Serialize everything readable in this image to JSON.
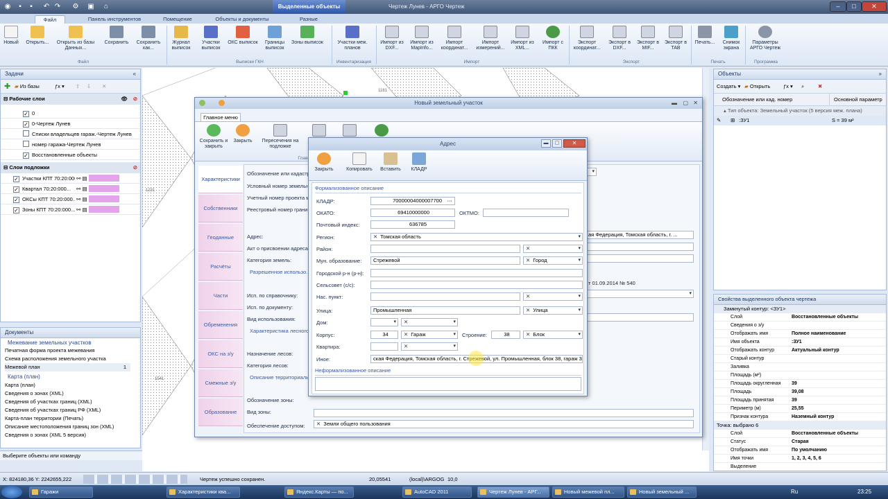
{
  "titlebar": {
    "context_tab": "Выделенные объекты",
    "app_title": "Чертеж Лунев - АРГО Чертеж"
  },
  "ribbon_tabs": [
    "Файл",
    "Панель инструментов",
    "Помещение",
    "Объекты и документы",
    "Разные"
  ],
  "ribbon": {
    "buttons": [
      "Новый",
      "Открыть...",
      "Открыть из базы Данных...",
      "Сохранить",
      "Сохранить как...",
      "Журнал выписок",
      "Участки выписок",
      "ОКС выписок",
      "Границы выписок",
      "Зоны выписок",
      "Участки меж. планов",
      "Импорт из DXF...",
      "Импорт из MapInfo...",
      "Импорт координат...",
      "Импорт измерений...",
      "Импорт из XML...",
      "Импорт с ПКК",
      "Экспорт координат...",
      "Экспорт в DXF...",
      "Экспорт в MIF...",
      "Экспорт в TAB",
      "Печать...",
      "Снимок экрана",
      "Параметры АРГО Чертеж"
    ],
    "groups": [
      "Файл",
      "Выписки ГКН",
      "Инвентаризация",
      "Импорт",
      "Экспорт",
      "Печать",
      "Программа"
    ]
  },
  "tasks": {
    "title": "Задачи",
    "from_db": "Из базы",
    "work_layers": {
      "title": "Рабочие слои",
      "items": [
        "0",
        "0-Чертеж Лунев",
        "Списки владельцев гараж.-Чертеж Лунев",
        "номер гаража-Чертеж Лунев",
        "Восстановленные объекты"
      ]
    },
    "base_layers": {
      "title": "Слои подложки",
      "items": [
        "Участки КПТ 70:20:000...",
        "Квартал 70:20:000...",
        "ОКСы КПТ 70:20:000...",
        "Зоны КПТ 70:20:000..."
      ]
    }
  },
  "documents": {
    "title": "Документы",
    "group1": "Межевание земельных участков",
    "items1": [
      "Печатная форма проекта межевания",
      "Схема расположения земельного участка",
      "Межевой план"
    ],
    "count": "1",
    "group2": "Карта (план)",
    "items2": [
      "Карта (план)",
      "Сведения о зонах (XML)",
      "Сведения об участках границ (XML)",
      "Сведения об участках границ РФ (XML)",
      "Карта-план территории (Печать)",
      "Описание местоположения границ зон (XML)",
      "Сведения о зонах (XML 5 версия)"
    ]
  },
  "command_hint": "Выберите объекты или команду",
  "map_labels": [
    "1181",
    "1231",
    "1541"
  ],
  "land_window": {
    "title": "Новый земельный участок",
    "menu_tab": "Главное меню",
    "buttons": [
      "Сохранить и закрыть",
      "Закрыть",
      "Пересечения на подложке"
    ],
    "menu_group": "Главное меню",
    "tabs": [
      "Характеристики",
      "Собственники",
      "Геоданные",
      "Расчёты",
      "Части",
      "Обременения",
      "ОКС на з/у",
      "Смежные з/у",
      "Образование"
    ],
    "labels": [
      "Обозначение или кадастр...",
      "Условный номер земельно...",
      "Учетный номер проекта м...",
      "Реестровый номер границ...",
      "Адрес:",
      "Акт о присвоении адреса:",
      "Категория земель:",
      "Исп. по справочнику:",
      "Исп. по документу:",
      "Вид использования:",
      "Назначение лесов:",
      "Категория лесов:",
      "Обозначение зоны:",
      "Вид зоны:",
      "Обеспечение доступом:"
    ],
    "sections": [
      "Разрешенное использо...",
      "Характеристика лесного ...",
      "Описание территориальн..."
    ],
    "address_value": "ая Федерация, Томская область, г. ...",
    "decree": "т 01.09.2014 № 540",
    "access_value": "Земли общего пользования"
  },
  "address_window": {
    "title": "Адрес",
    "buttons": [
      "Закрыть",
      "Копировать",
      "Вставить",
      "КЛАДР"
    ],
    "formal": "Формализованное описание",
    "informal": "Неформализованное описание",
    "fields": {
      "kladr_label": "КЛАДР:",
      "kladr": "70000004000007700",
      "okato_label": "ОКАТО:",
      "okato": "69410000000",
      "oktmo_label": "ОКТМО:",
      "oktmo": "",
      "postal_label": "Почтовый индекс:",
      "postal": "636785",
      "region_label": "Регион:",
      "region": "Томская область",
      "district_label": "Район:",
      "mun_label": "Мун. образование:",
      "mun": "Стрежевой",
      "mun_type": "Город",
      "city_district_label": "Городской р-н (р-н):",
      "village_council_label": "Сельсовет (с/с):",
      "locality_label": "Нас. пункт:",
      "street_label": "Улица:",
      "street": "Промышленная",
      "street_type": "Улица",
      "house_label": "Дом:",
      "corpus_label": "Корпус:",
      "corpus": "34",
      "corpus_type": "Гараж",
      "building_label": "Строение:",
      "building": "38",
      "building_type": "Блок",
      "apartment_label": "Квартира:",
      "other_label": "Иное:",
      "other": "ская Федерация, Томская область, г. Стрежевой, ул. Промышленная, блок 38, гараж 34"
    }
  },
  "objects": {
    "title": "Объекты",
    "create": "Создать",
    "open": "Открыть",
    "col1": "Обозначение или кад. номер",
    "col2": "Основной параметр",
    "group": "Тип объекта: Земельный участок (5 версия меж. плана)",
    "item_name": ":ЗУ1",
    "item_param": "S = 39 м²"
  },
  "properties": {
    "title": "Свойства выделенного объекта чертежа",
    "contour_header": "Замкнутый контур: <ЗУ1>",
    "rows1": [
      [
        "Слой",
        "Восстановленные объекты"
      ],
      [
        "Сведения о з/у",
        ""
      ],
      [
        "Отображать имя",
        "Полное наименование"
      ],
      [
        "Имя объекта",
        ":ЗУ1"
      ],
      [
        "Отображать контур",
        "Актуальный контур"
      ],
      [
        "Старый контур",
        ""
      ],
      [
        "Заливка",
        ""
      ],
      [
        "Площадь (м²)",
        ""
      ],
      [
        "Площадь округленная",
        "39"
      ],
      [
        "Площадь",
        "39,08"
      ],
      [
        "Площадь принятая",
        "39"
      ],
      [
        "Периметр (м)",
        "25,55"
      ],
      [
        "Признак контура",
        "Наземный контур"
      ]
    ],
    "point_header": "Точка: выбрано 6",
    "rows2": [
      [
        "Слой",
        "Восстановленные объекты"
      ],
      [
        "Статус",
        "Старая"
      ],
      [
        "Отображать имя",
        "По умолчанию"
      ],
      [
        "Имя точки",
        "1, 2, 3, 4, 5, 6"
      ],
      [
        "Выделение",
        ""
      ]
    ]
  },
  "status": {
    "coords": "X: 824180,36 Y: 2242655,222",
    "message": "Чертеж успешно сохранен.",
    "scale": "20,05541",
    "db": "(local)\\ARGOG",
    "zoom": "10,0"
  },
  "taskbar": {
    "items": [
      "Гаражи",
      "Характеристики ква...",
      "Яндекс.Карты — по...",
      "AutoCAD 2011",
      "Чертеж Лунев - АРГ...",
      "Новый межевой пл...",
      "Новый земельный ..."
    ],
    "lang": "Ru",
    "time": "23:25"
  },
  "colors": {
    "accent": "#3a5d8c",
    "pink": "#e4a4ec",
    "tab_pink": "#f0d2ea"
  }
}
